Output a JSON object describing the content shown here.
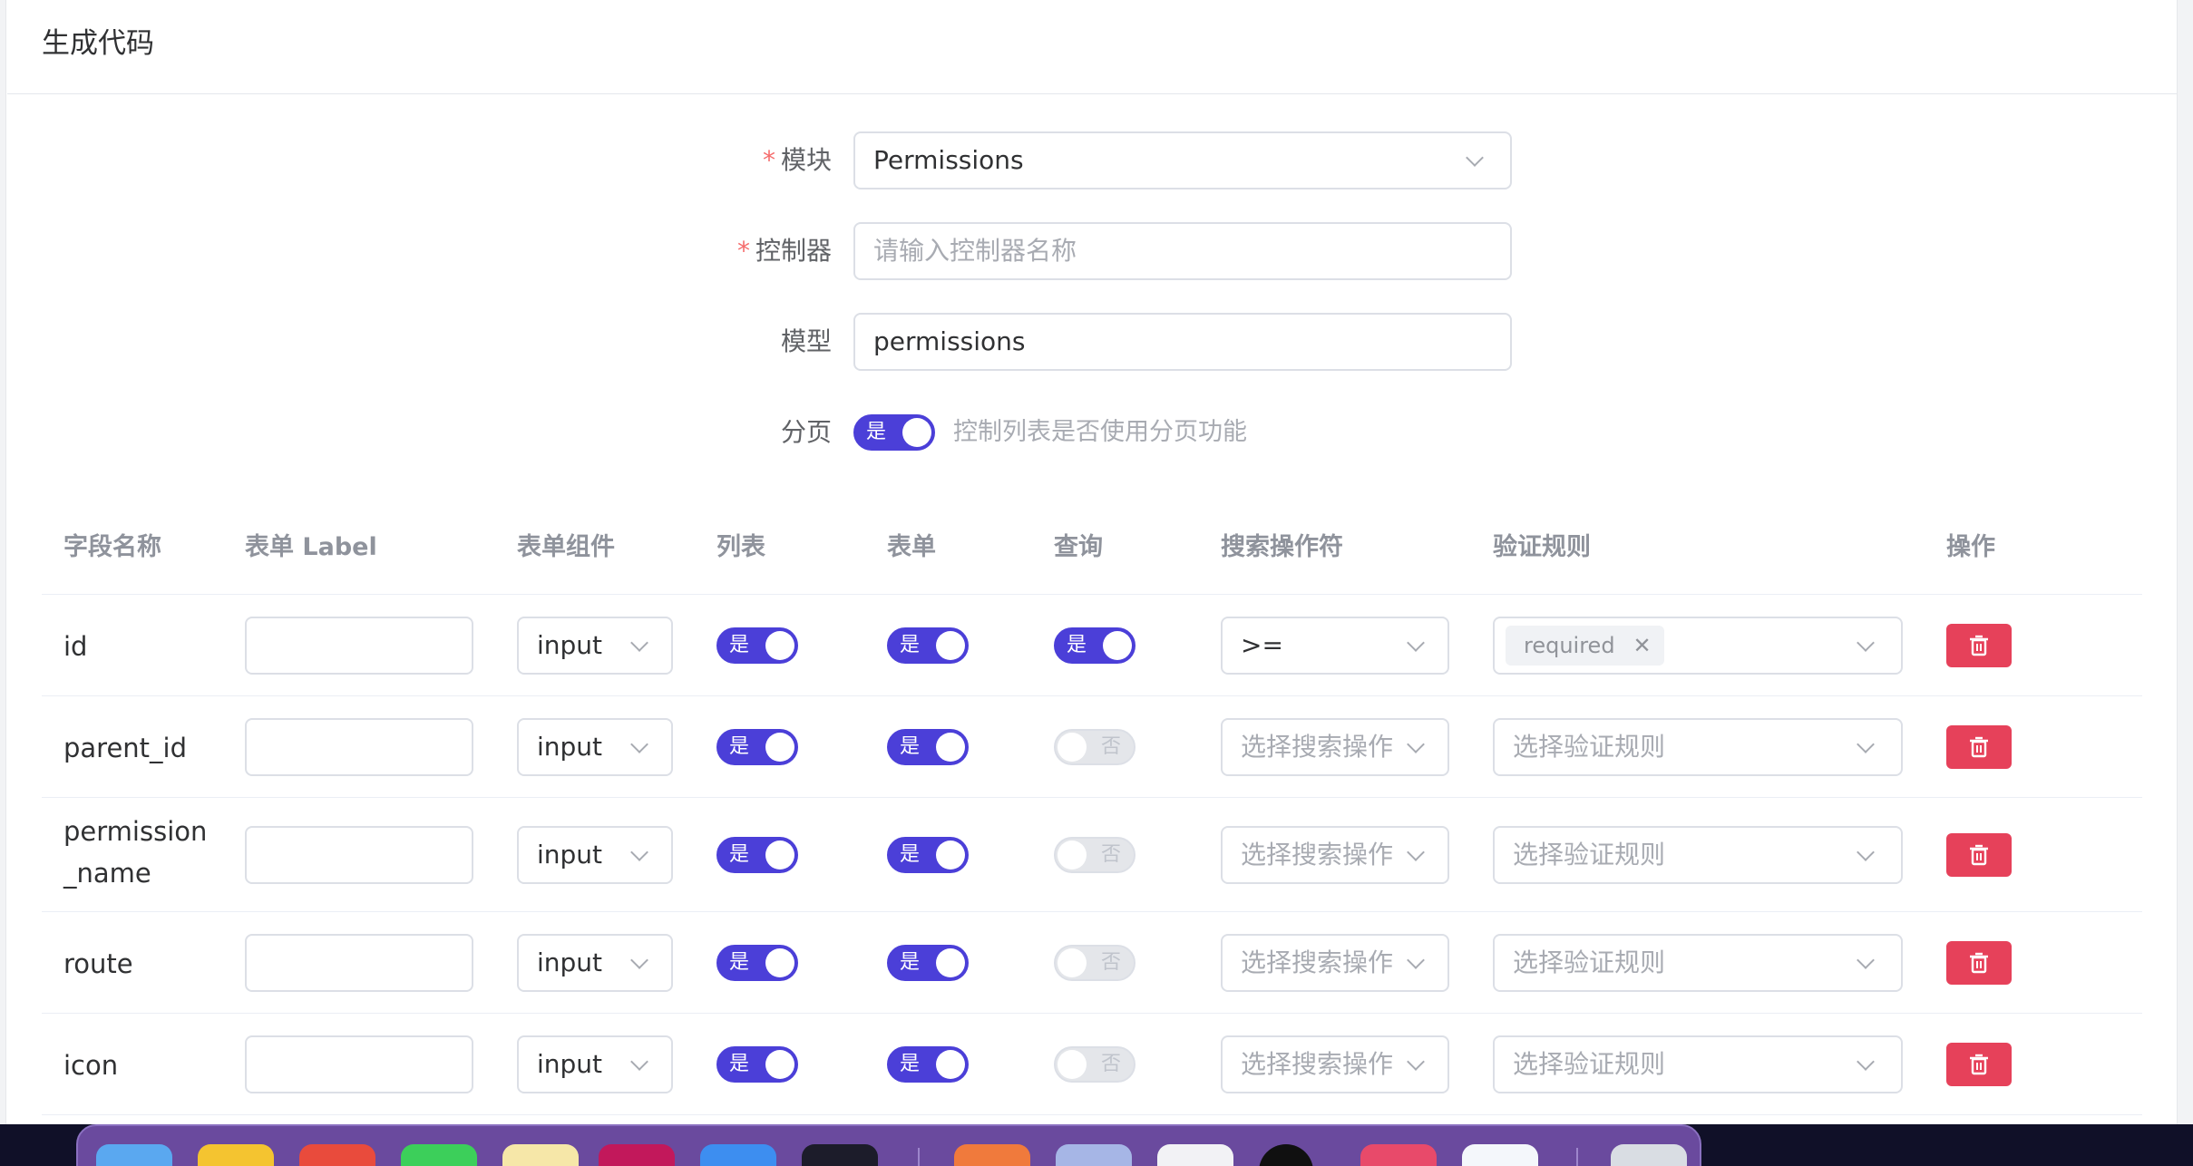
{
  "card": {
    "title": "生成代码"
  },
  "form": {
    "module": {
      "label": "模块",
      "value": "Permissions"
    },
    "controller": {
      "label": "控制器",
      "placeholder": "请输入控制器名称"
    },
    "model": {
      "label": "模型",
      "value": "permissions"
    },
    "pagination": {
      "label": "分页",
      "switch_text": "是",
      "hint": "控制列表是否使用分页功能"
    }
  },
  "table": {
    "headers": [
      "字段名称",
      "表单 Label",
      "表单组件",
      "列表",
      "表单",
      "查询",
      "搜索操作符",
      "验证规则",
      "操作"
    ],
    "rows": [
      {
        "field": "id",
        "component": "input",
        "list": "是",
        "form": "是",
        "query": "是",
        "operator": ">=",
        "rule_tag": "required"
      },
      {
        "field": "parent_id",
        "component": "input",
        "list": "是",
        "form": "是",
        "query": "否",
        "operator_placeholder": "选择搜索操作",
        "rule_placeholder": "选择验证规则"
      },
      {
        "field_line1": "permission",
        "field_line2": "_name",
        "component": "input",
        "list": "是",
        "form": "是",
        "query": "否",
        "operator_placeholder": "选择搜索操作",
        "rule_placeholder": "选择验证规则"
      },
      {
        "field": "route",
        "component": "input",
        "list": "是",
        "form": "是",
        "query": "否",
        "operator_placeholder": "选择搜索操作",
        "rule_placeholder": "选择验证规则"
      },
      {
        "field": "icon",
        "component": "input",
        "list": "是",
        "form": "是",
        "query": "否",
        "operator_placeholder": "选择搜索操作",
        "rule_placeholder": "选择验证规则"
      }
    ]
  },
  "colors": {
    "accent": "#4b3fd8",
    "danger": "#e6415a",
    "required": "#f56c6c"
  },
  "icons": {
    "select": "chevron-down-icon",
    "delete": "trash-icon",
    "tag_close": "close-icon"
  }
}
